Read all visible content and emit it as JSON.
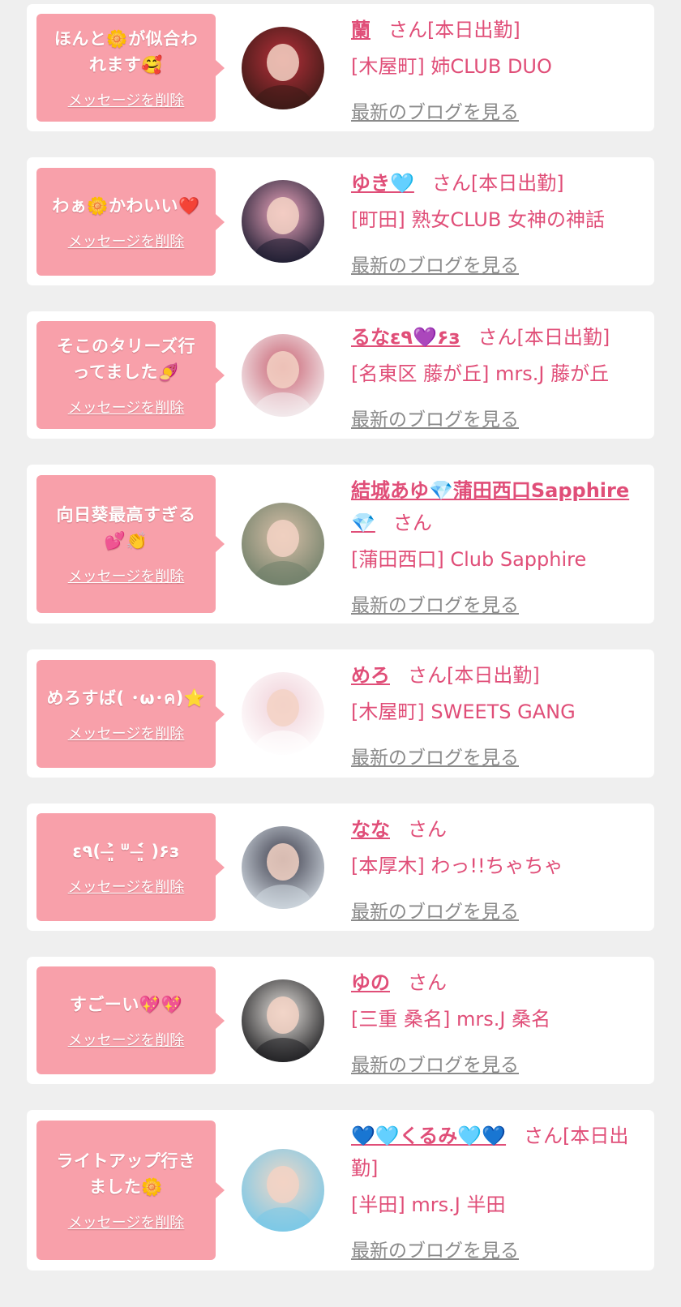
{
  "delete_label": "メッセージを削除",
  "blog_label": "最新のブログを見る",
  "colors": {
    "background": "#efefef",
    "card": "#ffffff",
    "bubble": "#f8a0aa",
    "accent": "#e04e78",
    "link_gray": "#8a8a8a"
  },
  "entries": [
    {
      "message": "ほんと🌼が似合わ\nれます🥰",
      "name": "蘭",
      "suffix": "さん[本日出勤]",
      "shop": "[木屋町] 姉CLUB DUO",
      "avatar_colors": [
        "#3a1a16",
        "#b8303a"
      ]
    },
    {
      "message": "わぁ🌼かわいい❤️",
      "name": "ゆき🩵",
      "suffix": "さん[本日出勤]",
      "shop": "[町田] 熟女CLUB 女神の神話",
      "avatar_colors": [
        "#1c1c30",
        "#f0a8c0"
      ]
    },
    {
      "message": "そこのタリーズ行\nってました🍠",
      "name": "るなε٩💜۶з",
      "suffix": "さん[本日出勤]",
      "shop": "[名東区 藤が丘] mrs.J 藤が丘",
      "avatar_colors": [
        "#f4eef0",
        "#c86070"
      ]
    },
    {
      "message": "向日葵最高すぎる\n💕👏",
      "name": "結城あゆ💎蒲田西口Sapphire\n💎",
      "suffix": "さん",
      "shop": "[蒲田西口] Club Sapphire",
      "avatar_colors": [
        "#70806a",
        "#d8c0a8"
      ]
    },
    {
      "message": "めろすば( ･ω･ค)⭐",
      "name": "めろ",
      "suffix": "さん[本日出勤]",
      "shop": "[木屋町] SWEETS GANG",
      "avatar_colors": [
        "#ffffff",
        "#f0d0d8"
      ]
    },
    {
      "message": "ε٩( ˃̶͈̀ ᐜ ˂̶͈́ )۶з",
      "name": "なな",
      "suffix": "さん",
      "shop": "[本厚木] わっ!!ちゃちゃ",
      "avatar_colors": [
        "#d0d8e0",
        "#3a3a48"
      ]
    },
    {
      "message": "すごーい💖💖",
      "name": "ゆの",
      "suffix": "さん",
      "shop": "[三重 桑名] mrs.J 桑名",
      "avatar_colors": [
        "#1e1e20",
        "#e8e4e0"
      ]
    },
    {
      "message": "ライトアップ行き\nました🌼",
      "name": "💙🩵くるみ🩵💙",
      "suffix": "さん[本日出\n勤]",
      "shop": "[半田] mrs.J 半田",
      "avatar_colors": [
        "#78c8e8",
        "#f0d8c8"
      ]
    }
  ]
}
